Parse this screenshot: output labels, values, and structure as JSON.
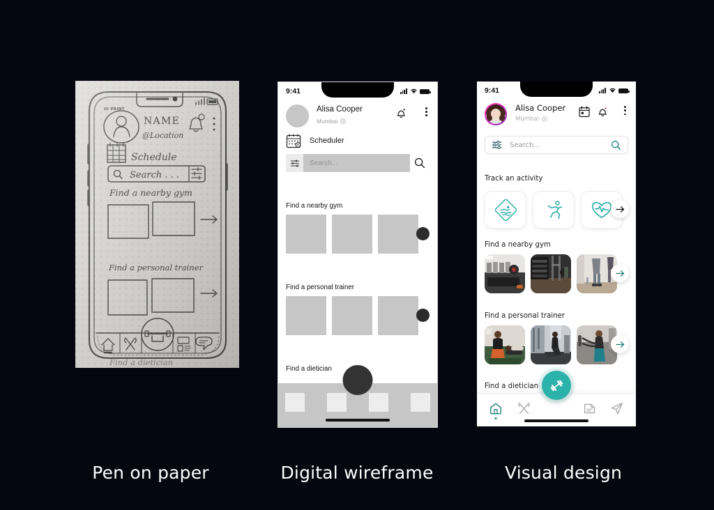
{
  "background_color": "#05060f",
  "captions": [
    {
      "id": "pen-on-paper",
      "label": "Pen on paper"
    },
    {
      "id": "digital-wireframe",
      "label": "Digital wireframe"
    },
    {
      "id": "visual-design",
      "label": "Visual design"
    }
  ],
  "colors": {
    "accent_teal": "#2bb3ab",
    "accent_teal_dark": "#1f8a82",
    "avatar_ring": "#ff2fa0",
    "wireframe_gray": "#c6c6c6",
    "wireframe_light": "#ededed",
    "paper": "#d6d5d2",
    "ink": "#4a4a4a",
    "caption_text": "#ffffff"
  },
  "sketch": {
    "brand_mark": "UI PRINT",
    "name_label": "NAME",
    "location_label": "@Location",
    "schedule_label": "Schedule",
    "search_label": "Search . . .",
    "section_gym": "Find a nearby gym",
    "section_trainer": "Find a personal trainer",
    "section_dietician": "Find a dietician",
    "icons": {
      "profile": "avatar-icon",
      "notification": "bell-icon",
      "menu": "kebab-menu-icon",
      "calendar": "calendar-icon",
      "search": "magnifier-icon",
      "filter": "sliders-icon",
      "arrow": "arrow-right-icon",
      "fab": "dumbbell-icon",
      "nav": [
        "home-icon",
        "cutlery-icon",
        "document-icon",
        "chat-icon"
      ]
    }
  },
  "wireframe": {
    "status": {
      "time": "9:41",
      "signal": "signal-icon",
      "wifi": "wifi-icon",
      "battery": "battery-icon"
    },
    "profile": {
      "name": "Alisa Cooper",
      "location": "Mumbai",
      "location_pin": "location-pin-icon",
      "avatar": "avatar-placeholder",
      "bell": "bell-icon",
      "menu": "kebab-menu-icon"
    },
    "scheduler": {
      "label": "Scheduler",
      "icon": "calendar-icon"
    },
    "search": {
      "placeholder": "Search...",
      "filter_icon": "sliders-icon",
      "search_icon": "magnifier-icon"
    },
    "sections": [
      {
        "title": "Find a nearby gym",
        "tiles": 3,
        "has_arrow_blob": true
      },
      {
        "title": "Find a personal trainer",
        "tiles": 3,
        "has_arrow_blob": true
      },
      {
        "title": "Find a dietician",
        "tiles": 0,
        "has_arrow_blob": false
      }
    ],
    "tabbar": {
      "tabs": 4,
      "fab": "fab-placeholder",
      "home_indicator": true
    }
  },
  "visual": {
    "status": {
      "time": "9:41",
      "signal": "signal-icon",
      "wifi": "wifi-icon",
      "battery": "battery-icon"
    },
    "profile": {
      "name": "Alisa Cooper",
      "location": "Mumbai",
      "location_pin": "location-pin-icon",
      "avatar": "user-photo",
      "calendar": "calendar-icon",
      "bell": "bell-icon",
      "menu": "kebab-menu-icon"
    },
    "search": {
      "placeholder": "Search...",
      "filter_icon": "sliders-icon",
      "search_icon": "magnifier-icon"
    },
    "activity": {
      "title": "Track an activity",
      "cards": [
        {
          "name": "swimming",
          "icon": "swimming-diamond-icon"
        },
        {
          "name": "running",
          "icon": "running-person-icon"
        },
        {
          "name": "heart-rate",
          "icon": "heart-pulse-icon"
        }
      ],
      "arrow": "arrow-right-icon"
    },
    "sections": [
      {
        "title": "Find a nearby gym",
        "cards": 3,
        "arrow": "arrow-right-icon"
      },
      {
        "title": "Find a personal trainer",
        "cards": 3,
        "arrow": "arrow-right-icon"
      },
      {
        "title": "Find a dietician",
        "cards": 0,
        "arrow": null
      }
    ],
    "tabbar": {
      "items": [
        {
          "name": "home",
          "icon": "home-icon",
          "active": true
        },
        {
          "name": "nutrition",
          "icon": "cutlery-icon",
          "active": false
        },
        {
          "name": "documents",
          "icon": "document-icon",
          "active": false
        },
        {
          "name": "messages",
          "icon": "send-icon",
          "active": false
        }
      ],
      "fab": {
        "icon": "dumbbell-icon",
        "color": "#2bb3ab"
      },
      "home_indicator": true
    }
  }
}
